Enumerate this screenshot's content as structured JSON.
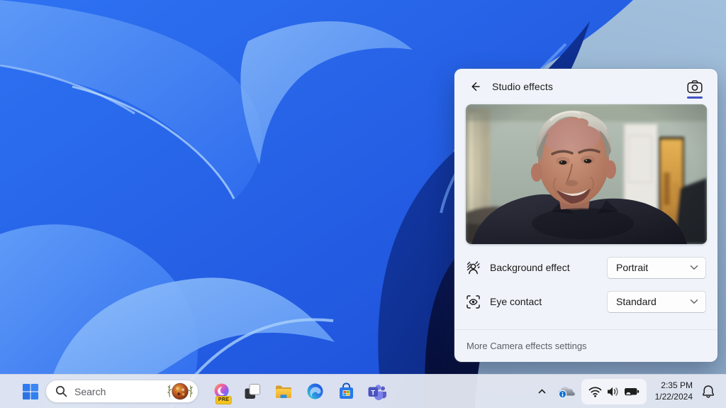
{
  "accent_color": "#4453c2",
  "panel": {
    "title": "Studio effects",
    "rows": [
      {
        "icon": "background-effect-icon",
        "label": "Background effect",
        "value": "Portrait"
      },
      {
        "icon": "eye-contact-icon",
        "label": "Eye contact",
        "value": "Standard"
      }
    ],
    "footer_link": "More Camera effects settings"
  },
  "taskbar": {
    "search_placeholder": "Search",
    "apps": [
      {
        "name": "copilot",
        "badge": "PRE"
      },
      {
        "name": "task-view"
      },
      {
        "name": "file-explorer"
      },
      {
        "name": "edge"
      },
      {
        "name": "microsoft-store"
      },
      {
        "name": "teams",
        "logo_letter": "T"
      }
    ],
    "tray": {
      "time": "2:35 PM",
      "date": "1/22/2024"
    }
  },
  "icons": {
    "header": [
      "arrow-left",
      "camera-outline"
    ],
    "rows": [
      "person-with-hatched-background",
      "eye-in-focus-brackets",
      "chevron-down"
    ],
    "taskbar": [
      "windows-logo",
      "magnifier",
      "bing-daily-image"
    ],
    "tray": [
      "chevron-up",
      "onedrive-cloud-info",
      "wifi",
      "speaker",
      "battery-charging",
      "notification-bell"
    ]
  }
}
